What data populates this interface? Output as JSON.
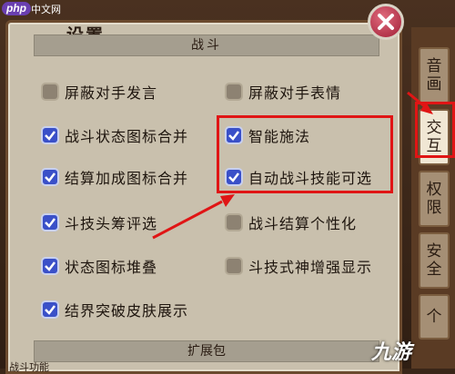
{
  "window": {
    "title": "设置",
    "watermark_logo": "php",
    "watermark_text": "中文网"
  },
  "sections": {
    "battle_header": "战斗",
    "extension_header": "扩展包"
  },
  "options": [
    {
      "label": "屏蔽对手发言",
      "checked": false
    },
    {
      "label": "屏蔽对手表情",
      "checked": false
    },
    {
      "label": "战斗状态图标合并",
      "checked": true
    },
    {
      "label": "智能施法",
      "checked": true
    },
    {
      "label": "结算加成图标合并",
      "checked": true
    },
    {
      "label": "自动战斗技能可选",
      "checked": true
    },
    {
      "label": "斗技头筹评选",
      "checked": true
    },
    {
      "label": "战斗结算个性化",
      "checked": false
    },
    {
      "label": "状态图标堆叠",
      "checked": true
    },
    {
      "label": "斗技式神增强显示",
      "checked": false
    },
    {
      "label": "结界突破皮肤展示",
      "checked": true
    }
  ],
  "side_tabs": [
    {
      "line1": "音",
      "line2": "画",
      "active": false
    },
    {
      "line1": "交",
      "line2": "互",
      "active": true
    },
    {
      "line1": "权",
      "line2": "限",
      "active": false
    },
    {
      "line1": "安",
      "line2": "全",
      "active": false
    },
    {
      "line1": "个",
      "line2": "",
      "active": false
    }
  ],
  "footer_text": "战斗功能",
  "corner_logo": "九游",
  "colors": {
    "checkbox_on": "#3a50c8",
    "annotation_red": "#e01515",
    "panel_bg": "#c9c0ad"
  }
}
